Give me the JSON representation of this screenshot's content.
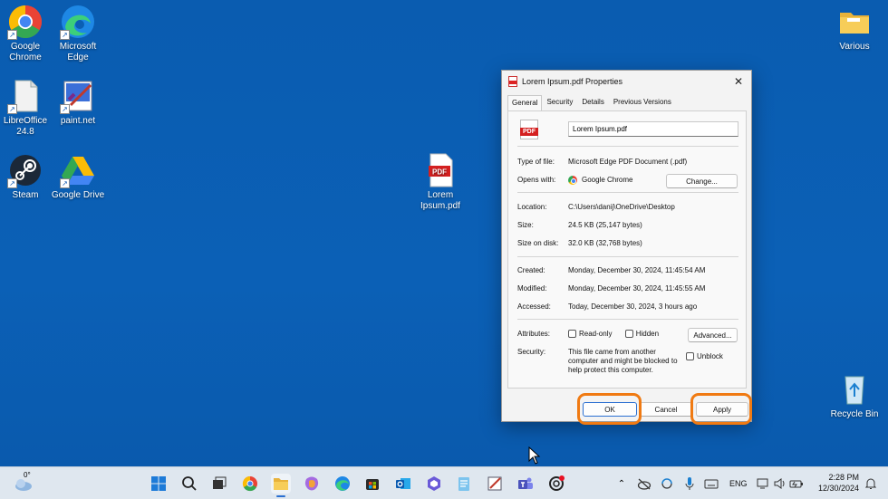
{
  "desktop": {
    "icons": [
      {
        "label": "Google\nChrome",
        "icon": "chrome-icon"
      },
      {
        "label": "Microsoft\nEdge",
        "icon": "edge-icon"
      },
      {
        "label": "LibreOffice\n24.8",
        "icon": "libreoffice-icon"
      },
      {
        "label": "paint.net",
        "icon": "paintnet-icon"
      },
      {
        "label": "Steam",
        "icon": "steam-icon"
      },
      {
        "label": "Google Drive",
        "icon": "google-drive-icon"
      },
      {
        "label": "Lorem\nIpsum.pdf",
        "icon": "pdf-file-icon"
      },
      {
        "label": "Various",
        "icon": "folder-icon"
      },
      {
        "label": "Recycle Bin",
        "icon": "recycle-bin-icon"
      }
    ]
  },
  "dialog": {
    "title": "Lorem Ipsum.pdf Properties",
    "tabs": [
      "General",
      "Security",
      "Details",
      "Previous Versions"
    ],
    "filename": "Lorem Ipsum.pdf",
    "type_label": "Type of file:",
    "type_value": "Microsoft Edge PDF Document (.pdf)",
    "opens_label": "Opens with:",
    "opens_value": "Google Chrome",
    "change_button": "Change...",
    "location_label": "Location:",
    "location_value": "C:\\Users\\danij\\OneDrive\\Desktop",
    "size_label": "Size:",
    "size_value": "24.5 KB (25,147 bytes)",
    "disk_label": "Size on disk:",
    "disk_value": "32.0 KB (32,768 bytes)",
    "created_label": "Created:",
    "created_value": "Monday, December 30, 2024, 11:45:54 AM",
    "modified_label": "Modified:",
    "modified_value": "Monday, December 30, 2024, 11:45:55 AM",
    "accessed_label": "Accessed:",
    "accessed_value": "Today, December 30, 2024, 3 hours ago",
    "attributes_label": "Attributes:",
    "readonly_label": "Read-only",
    "hidden_label": "Hidden",
    "advanced_button": "Advanced...",
    "security_label": "Security:",
    "security_text": "This file came from another computer and might be blocked to help protect this computer.",
    "unblock_label": "Unblock",
    "ok_button": "OK",
    "cancel_button": "Cancel",
    "apply_button": "Apply",
    "highlight_color": "#f07a12"
  },
  "taskbar": {
    "weather_temp": "0°",
    "language": "ENG",
    "time": "2:28 PM",
    "date": "12/30/2024"
  }
}
